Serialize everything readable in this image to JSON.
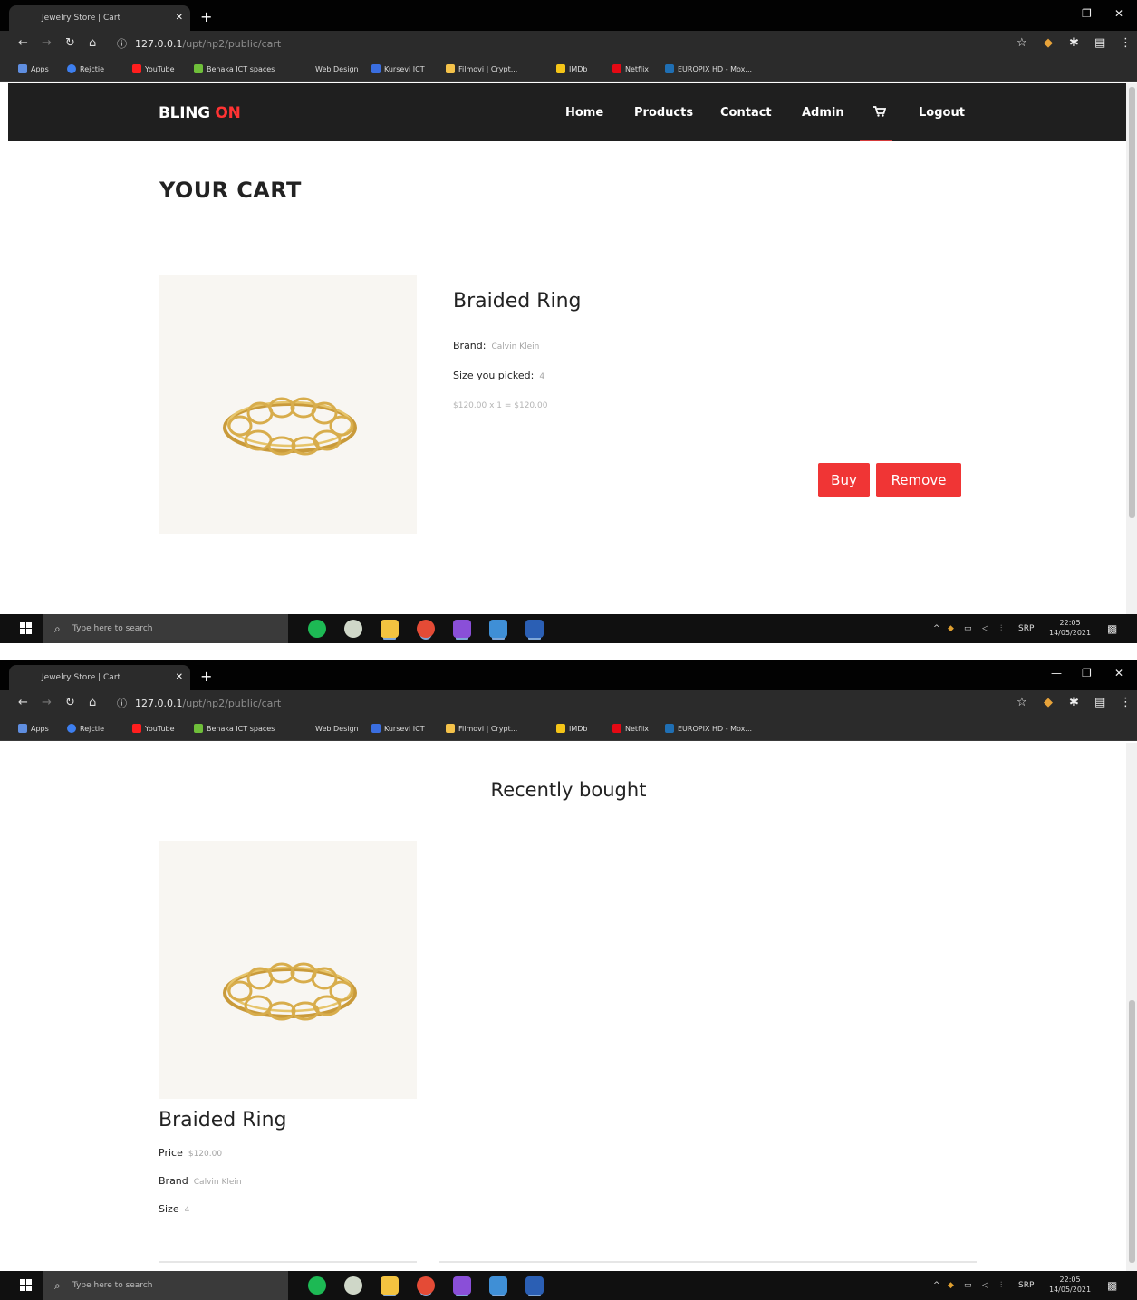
{
  "browser": {
    "tab_title": "Jewelry Store | Cart",
    "url_host": "127.0.0.1",
    "url_path": "/upt/hp2/public/cart",
    "bookmarks": [
      "Apps",
      "Rejctie",
      "YouTube",
      "Benaka ICT spaces",
      "Web Design",
      "Kursevi ICT",
      "Filmovi | Crypt...",
      "IMDb",
      "Netflix",
      "EUROPIX HD - Mox..."
    ]
  },
  "site": {
    "logo_main": "BLING",
    "logo_accent": "ON",
    "nav": {
      "home": "Home",
      "products": "Products",
      "contact": "Contact",
      "admin": "Admin",
      "cart_icon": "cart-icon",
      "logout": "Logout"
    }
  },
  "cart": {
    "heading": "YOUR CART",
    "item": {
      "name": "Braided Ring",
      "brand_label": "Brand:",
      "brand": "Calvin Klein",
      "size_label": "Size you picked:",
      "size": "4",
      "calc": "$120.00 x 1 = $120.00"
    },
    "buy_label": "Buy",
    "remove_label": "Remove"
  },
  "recent": {
    "heading": "Recently bought",
    "item": {
      "name": "Braided Ring",
      "price_label": "Price",
      "price": "$120.00",
      "brand_label": "Brand",
      "brand": "Calvin Klein",
      "size_label": "Size",
      "size": "4"
    }
  },
  "taskbar": {
    "search_placeholder": "Type here to search",
    "clock_time": "22:05",
    "clock_date": "14/05/2021",
    "lang": "SRP"
  },
  "colors": {
    "accent": "#f03535",
    "header_bg": "#1f1f1f",
    "image_bg": "#f8f6f2"
  }
}
